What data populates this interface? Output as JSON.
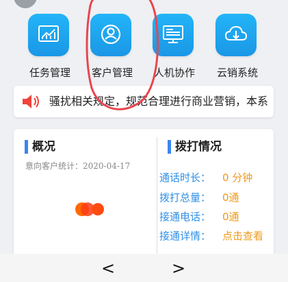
{
  "nav": {
    "back_symbol": "<",
    "prev_symbol": "<",
    "next_symbol": ">"
  },
  "menu": [
    {
      "label": "任务管理",
      "icon": "chart-icon"
    },
    {
      "label": "客户管理",
      "icon": "user-icon"
    },
    {
      "label": "人机协作",
      "icon": "monitor-icon"
    },
    {
      "label": "云销系统",
      "icon": "cloud-download-icon"
    }
  ],
  "notice": {
    "icon": "speaker-icon",
    "text": "骚扰相关规定，规范合理进行商业营销，本系"
  },
  "overview": {
    "title": "概况",
    "intent_stat_label": "意向客户统计：",
    "intent_stat_date": "2020-04-17"
  },
  "calls": {
    "title": "拨打情况",
    "rows": [
      {
        "label": "通话时长：",
        "value": "0 分钟"
      },
      {
        "label": "拨打总量：",
        "value": "0通"
      },
      {
        "label": "接通电话：",
        "value": "0通"
      },
      {
        "label": "接通详情：",
        "value": "点击查看"
      }
    ]
  },
  "colors": {
    "icon_blue": "#1a97e6",
    "accent_blue": "#3a86f0",
    "value_orange": "#ee9a1c",
    "annotation_red": "#e8464f"
  }
}
